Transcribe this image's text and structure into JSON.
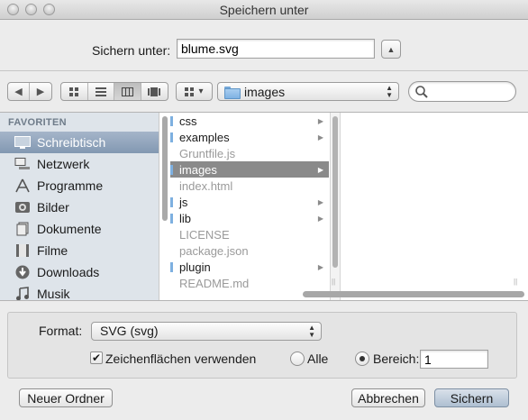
{
  "window": {
    "title": "Speichern unter"
  },
  "save_as": {
    "label": "Sichern unter:",
    "value": "blume.svg"
  },
  "toolbar": {
    "nav_back": "◀",
    "nav_forward": "▶",
    "path_popup": "images",
    "search_placeholder": ""
  },
  "sidebar": {
    "header": "FAVORITEN",
    "items": [
      {
        "label": "Schreibtisch",
        "icon": "desktop-icon",
        "selected": true
      },
      {
        "label": "Netzwerk",
        "icon": "network-icon"
      },
      {
        "label": "Programme",
        "icon": "applications-icon"
      },
      {
        "label": "Bilder",
        "icon": "pictures-icon"
      },
      {
        "label": "Dokumente",
        "icon": "documents-icon"
      },
      {
        "label": "Filme",
        "icon": "movies-icon"
      },
      {
        "label": "Downloads",
        "icon": "downloads-icon"
      },
      {
        "label": "Musik",
        "icon": "music-icon"
      }
    ]
  },
  "files": [
    {
      "name": "css",
      "folder": true
    },
    {
      "name": "examples",
      "folder": true
    },
    {
      "name": "Gruntfile.js",
      "folder": false
    },
    {
      "name": "images",
      "folder": true,
      "selected": true
    },
    {
      "name": "index.html",
      "folder": false
    },
    {
      "name": "js",
      "folder": true
    },
    {
      "name": "lib",
      "folder": true
    },
    {
      "name": "LICENSE",
      "folder": false
    },
    {
      "name": "package.json",
      "folder": false
    },
    {
      "name": "plugin",
      "folder": true
    },
    {
      "name": "README.md",
      "folder": false
    }
  ],
  "format": {
    "label": "Format:",
    "value": "SVG (svg)"
  },
  "options": {
    "use_artboards_label": "Zeichenflächen verwenden",
    "use_artboards_checked": true,
    "all_label": "Alle",
    "range_label": "Bereich:",
    "range_value": "1"
  },
  "buttons": {
    "new_folder": "Neuer Ordner",
    "cancel": "Abbrechen",
    "save": "Sichern"
  }
}
